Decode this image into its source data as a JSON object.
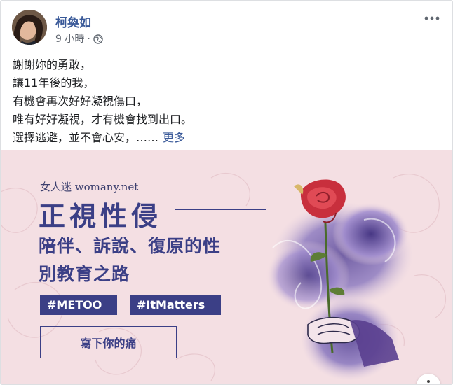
{
  "post": {
    "author": "柯奐如",
    "time": "9 小時",
    "meta_separator": "·",
    "icons": {
      "privacy": "globe-icon",
      "menu": "more-horizontal-icon",
      "options": "more-vertical-icon"
    },
    "text_lines": [
      "謝謝妳的勇敢，",
      "讓11年後的我，",
      "有機會再次好好凝視傷口，",
      "唯有好好凝視，才有機會找到出口。",
      "選擇逃避，並不會心安，……"
    ],
    "see_more": "更多"
  },
  "banner": {
    "brand": "女人迷 womany.net",
    "headline": "正視性侵",
    "subheadline_line1": "陪伴、訴說、復原的性",
    "subheadline_line2": "別教育之路",
    "tag1": "#METOO",
    "tag2": "#ItMatters",
    "cta": "寫下你的痛"
  },
  "colors": {
    "link": "#385898",
    "banner_bg": "#f4dfe3",
    "accent": "#3b3f86"
  }
}
